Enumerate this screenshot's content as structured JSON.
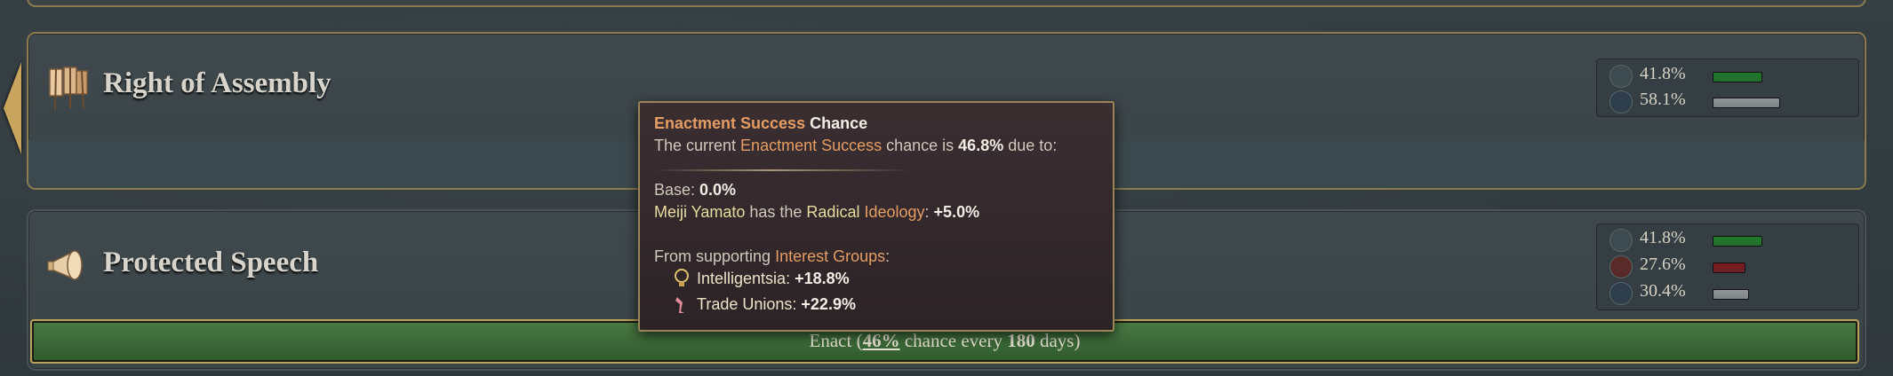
{
  "laws": [
    {
      "title": "Right of Assembly",
      "icon": "banner-icon",
      "support": [
        {
          "icon": "thumbs-up-icon",
          "pct": "41.8%",
          "fraction": 0.418,
          "color": "#1f7a2a"
        },
        {
          "icon": "neutral-icon",
          "pct": "58.1%",
          "fraction": 0.581,
          "color": "#8f9598"
        }
      ]
    },
    {
      "title": "Protected Speech",
      "icon": "megaphone-icon",
      "support": [
        {
          "icon": "thumbs-up-icon",
          "pct": "41.8%",
          "fraction": 0.418,
          "color": "#1f7a2a"
        },
        {
          "icon": "thumbs-down-icon",
          "pct": "27.6%",
          "fraction": 0.276,
          "color": "#7a1a1a"
        },
        {
          "icon": "neutral-icon",
          "pct": "30.4%",
          "fraction": 0.304,
          "color": "#8f9598"
        }
      ]
    }
  ],
  "enact": {
    "prefix": "Enact (",
    "chance": "46%",
    "middle": " chance every ",
    "days": "180",
    "suffix": " days)"
  },
  "tooltip": {
    "title_highlight": "Enactment Success",
    "title_rest": " Chance",
    "line1_pre": "The current ",
    "line1_term": "Enactment Success",
    "line1_mid": " chance is ",
    "line1_value": "46.8%",
    "line1_post": " due to:",
    "base_label": "Base: ",
    "base_value": "0.0%",
    "ideology_person": "Meiji Yamato",
    "ideology_mid": " has the ",
    "ideology_name": "Radical",
    "ideology_term": "Ideology",
    "ideology_colon": ": ",
    "ideology_value": "+5.0%",
    "groups_pre": "From supporting ",
    "groups_term": "Interest Groups",
    "groups_post": ":",
    "groups": [
      {
        "icon": "lightbulb-icon",
        "name": "Intelligentsia",
        "colon": ": ",
        "value": "+18.8%"
      },
      {
        "icon": "worker-icon",
        "name": "Trade Unions",
        "colon": ": ",
        "value": "+22.9%"
      }
    ]
  }
}
